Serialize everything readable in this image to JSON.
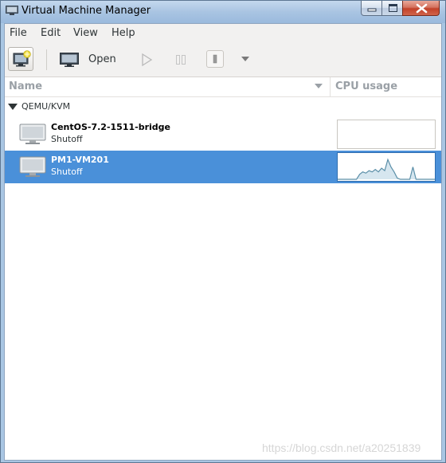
{
  "window": {
    "title": "Virtual Machine Manager"
  },
  "menubar": {
    "items": [
      "File",
      "Edit",
      "View",
      "Help"
    ]
  },
  "toolbar": {
    "new_vm_icon": "new-vm-icon",
    "open_label": "Open",
    "run_icon": "play-icon",
    "pause_icon": "pause-icon",
    "shutdown_icon": "power-icon",
    "dropdown_icon": "chevron-down-icon"
  },
  "list": {
    "columns": {
      "name": "Name",
      "cpu": "CPU usage"
    },
    "group": {
      "label": "QEMU/KVM",
      "expanded": true
    },
    "vms": [
      {
        "name": "CentOS-7.2-1511-bridge",
        "status": "Shutoff",
        "selected": false,
        "cpu_history": []
      },
      {
        "name": "PM1-VM201",
        "status": "Shutoff",
        "selected": true,
        "cpu_history": [
          0,
          0,
          0,
          0,
          0,
          0,
          0,
          20,
          30,
          25,
          35,
          30,
          40,
          30,
          45,
          35,
          80,
          50,
          30,
          5,
          0,
          0,
          0,
          0,
          50,
          0,
          0,
          0,
          0,
          0,
          0,
          0
        ]
      }
    ]
  },
  "colors": {
    "selection": "#4a90d9",
    "graph_line": "#5b8fa8",
    "graph_fill": "#d6e6ef"
  },
  "watermark": "https://blog.csdn.net/a20251839"
}
